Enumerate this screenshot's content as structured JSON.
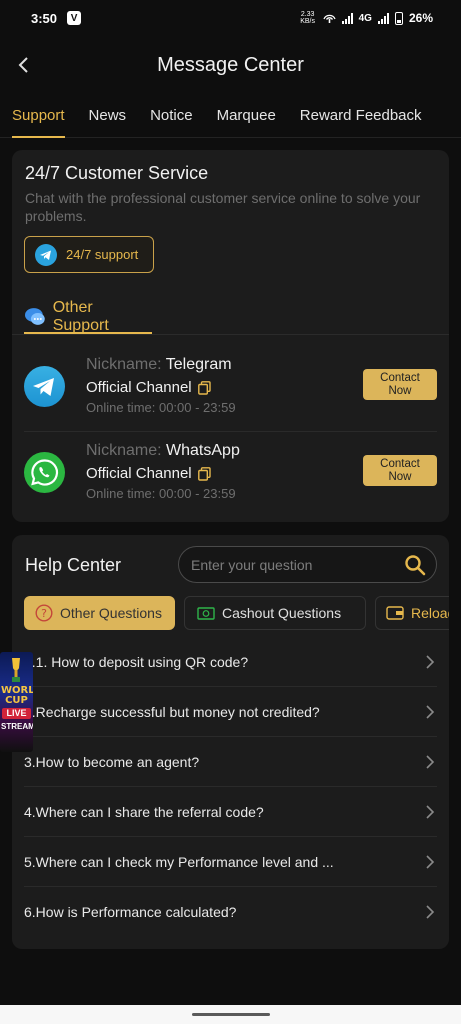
{
  "status_bar": {
    "time": "3:50",
    "app_icon": "V",
    "net_speed": "2.33\nKB/s",
    "network": "4G",
    "battery": "26%"
  },
  "header": {
    "title": "Message Center",
    "back_icon": "chevron-left-icon"
  },
  "tabs": [
    {
      "label": "Support",
      "active": true
    },
    {
      "label": "News",
      "active": false
    },
    {
      "label": "Notice",
      "active": false
    },
    {
      "label": "Marquee",
      "active": false
    },
    {
      "label": "Reward Feedback",
      "active": false
    }
  ],
  "customer_service": {
    "title": "24/7 Customer Service",
    "description": "Chat with the professional customer service online to solve your problems.",
    "support_button": "24/7 support",
    "other_support_label": "Other Support",
    "contacts": [
      {
        "nickname_label": "Nickname:",
        "nickname": "Telegram",
        "channel": "Official Channel",
        "online_time": "Online time:  00:00 - 23:59",
        "button": "Contact Now",
        "icon": "telegram-icon"
      },
      {
        "nickname_label": "Nickname:",
        "nickname": "WhatsApp",
        "channel": "Official Channel",
        "online_time": "Online time:  00:00 - 23:59",
        "button": "Contact Now",
        "icon": "whatsapp-icon"
      }
    ]
  },
  "help_center": {
    "title": "Help Center",
    "search_placeholder": "Enter your question",
    "categories": [
      {
        "label": "Other Questions",
        "active": true
      },
      {
        "label": "Cashout Questions",
        "active": false
      },
      {
        "label": "Reload",
        "active": false
      }
    ],
    "questions": [
      "1.1. How to deposit using QR code?",
      "2.Recharge successful but money not credited?",
      "3.How to become an agent?",
      "4.Where can I share the referral code?",
      "5.Where can I check my Performance level and ...",
      "6.How is Performance calculated?"
    ]
  },
  "floating_banner": {
    "line1": "WORLD CUP",
    "line2": "LIVE",
    "line3": "STREAM"
  },
  "colors": {
    "accent": "#e6b84d",
    "button_gold": "#dcb55a",
    "background": "#0e0e0e",
    "card": "#1c1c1c"
  }
}
